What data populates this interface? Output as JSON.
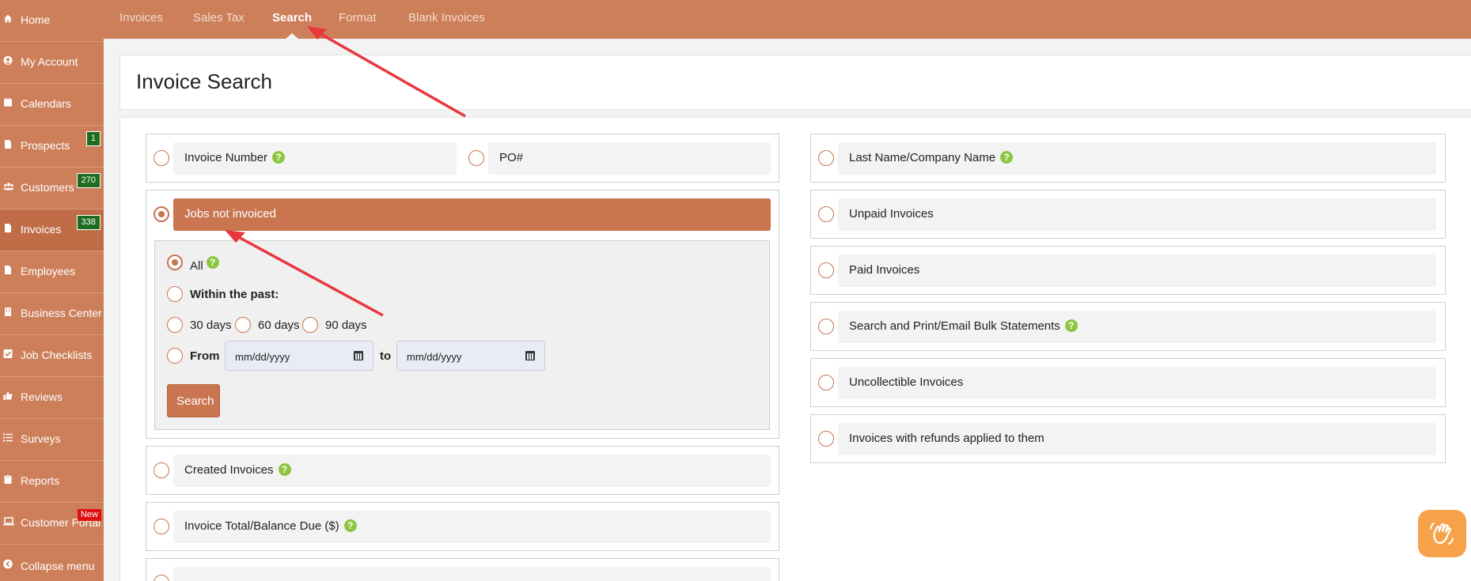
{
  "sidebar": {
    "items": [
      {
        "label": "Home",
        "icon": "home-icon"
      },
      {
        "label": "My Account",
        "icon": "user-circle-icon"
      },
      {
        "label": "Calendars",
        "icon": "calendar-icon"
      },
      {
        "label": "Prospects",
        "icon": "document-icon",
        "badge": "1"
      },
      {
        "label": "Customers",
        "icon": "users-icon",
        "badge": "270"
      },
      {
        "label": "Invoices",
        "icon": "document-icon",
        "badge": "338"
      },
      {
        "label": "Employees",
        "icon": "document-icon"
      },
      {
        "label": "Business Center",
        "icon": "building-icon"
      },
      {
        "label": "Job Checklists",
        "icon": "checkbox-icon"
      },
      {
        "label": "Reviews",
        "icon": "thumbs-up-icon"
      },
      {
        "label": "Surveys",
        "icon": "list-icon"
      },
      {
        "label": "Reports",
        "icon": "clipboard-icon"
      },
      {
        "label": "Customer Portal",
        "icon": "laptop-icon",
        "new_badge": "New"
      },
      {
        "label": "Collapse menu",
        "icon": "chevron-left-icon"
      }
    ]
  },
  "tabs": [
    "Invoices",
    "Sales Tax",
    "Search",
    "Format",
    "Blank Invoices"
  ],
  "page_title": "Invoice Search",
  "left_options": {
    "invoice_number": "Invoice Number",
    "po": "PO#",
    "jobs_not_invoiced": "Jobs not invoiced",
    "created_invoices": "Created Invoices",
    "invoice_total": "Invoice Total/Balance Due ($)"
  },
  "sub_panel": {
    "all": "All",
    "within_past": "Within the past:",
    "d30": "30 days",
    "d60": "60 days",
    "d90": "90 days",
    "from": "From",
    "to": "to",
    "date_placeholder": "mm/dd/yyyy",
    "search": "Search"
  },
  "right_options": [
    {
      "label": "Last Name/Company Name",
      "help": true
    },
    {
      "label": "Unpaid Invoices",
      "help": false
    },
    {
      "label": "Paid Invoices",
      "help": false
    },
    {
      "label": "Search and Print/Email Bulk Statements",
      "help": true
    },
    {
      "label": "Uncollectible Invoices",
      "help": false
    },
    {
      "label": "Invoices with refunds applied to them",
      "help": false
    }
  ],
  "colors": {
    "accent": "#cd7f5a",
    "badge_green": "#1f6b1f",
    "help_green": "#8cc63f",
    "arrow": "#e8383d"
  }
}
